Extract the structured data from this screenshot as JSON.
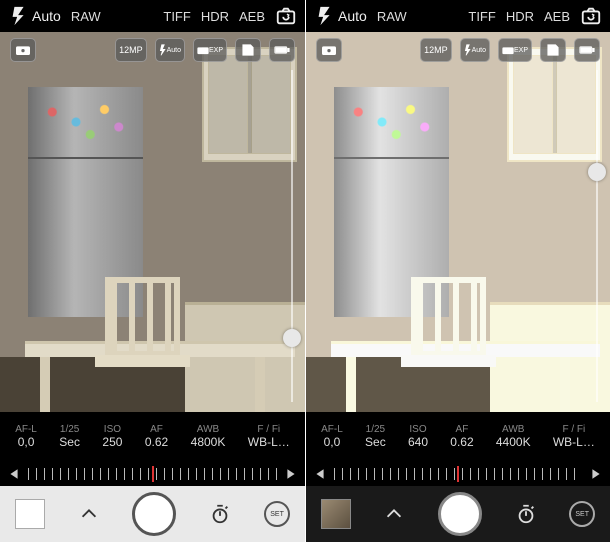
{
  "panes": [
    {
      "top": {
        "flash_mode": "Auto",
        "format": "RAW",
        "modes": [
          "TIFF",
          "HDR",
          "AEB"
        ]
      },
      "pill": {
        "res": "12MP",
        "flash": "Auto",
        "exp": "EXP"
      },
      "exposure_knob_pct": 78,
      "settings": [
        {
          "lbl": "AF-L",
          "val": "0,0"
        },
        {
          "lbl": "1/25",
          "val": "Sec"
        },
        {
          "lbl": "ISO",
          "val": "250"
        },
        {
          "lbl": "AF",
          "val": "0.62"
        },
        {
          "lbl": "AWB",
          "val": "4800K"
        },
        {
          "lbl": "F / Fi",
          "val": "WB-L…"
        }
      ],
      "bottom_style": "light",
      "thumb": "swatch",
      "set_label": "SET"
    },
    {
      "top": {
        "flash_mode": "Auto",
        "format": "RAW",
        "modes": [
          "TIFF",
          "HDR",
          "AEB"
        ]
      },
      "pill": {
        "res": "12MP",
        "flash": "Auto",
        "exp": "EXP"
      },
      "exposure_knob_pct": 28,
      "settings": [
        {
          "lbl": "AF-L",
          "val": "0,0"
        },
        {
          "lbl": "1/25",
          "val": "Sec"
        },
        {
          "lbl": "ISO",
          "val": "640"
        },
        {
          "lbl": "AF",
          "val": "0.62"
        },
        {
          "lbl": "AWB",
          "val": "4400K"
        },
        {
          "lbl": "F / Fi",
          "val": "WB-L…"
        }
      ],
      "bottom_style": "dark",
      "thumb": "photo",
      "set_label": "SET"
    }
  ]
}
